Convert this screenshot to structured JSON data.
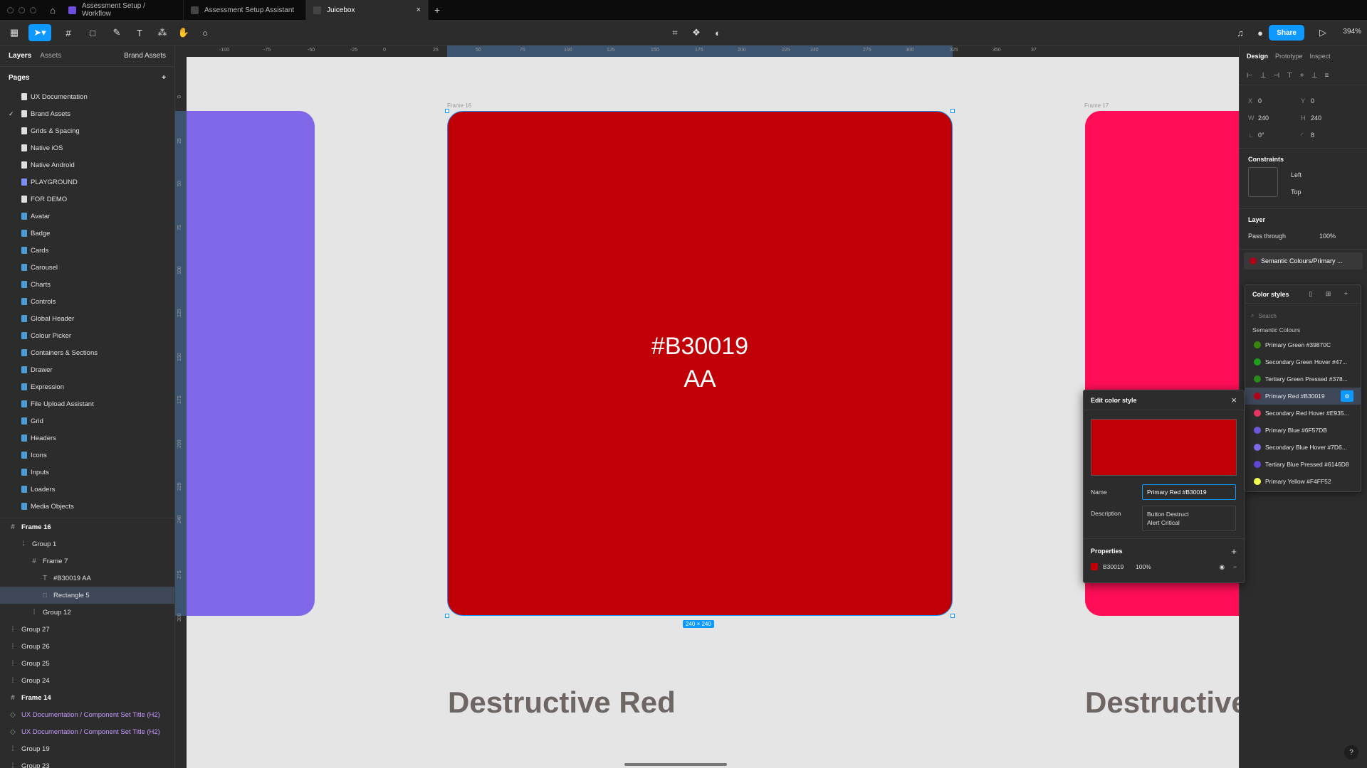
{
  "tabs": [
    {
      "label": "Assessment Setup / Workflow",
      "active": false
    },
    {
      "label": "Assessment Setup Assistant",
      "active": false
    },
    {
      "label": "Juicebox",
      "active": true
    }
  ],
  "toolbar": {
    "share_label": "Share",
    "zoom": "394%"
  },
  "left_panel": {
    "tab_layers": "Layers",
    "tab_assets": "Assets",
    "page_selector": "Brand Assets",
    "pages_title": "Pages",
    "pages": [
      "UX Documentation",
      "Brand Assets",
      "Grids & Spacing",
      "Native iOS",
      "Native Android",
      "PLAYGROUND",
      "FOR DEMO",
      "Avatar",
      "Badge",
      "Cards",
      "Carousel",
      "Charts",
      "Controls",
      "Global Header",
      "Colour Picker",
      "Containers & Sections",
      "Drawer",
      "Expression",
      "File Upload Assistant",
      "Grid",
      "Headers",
      "Icons",
      "Inputs",
      "Loaders",
      "Media Objects"
    ],
    "layers": [
      {
        "label": "Frame 16",
        "indent": 0,
        "icon": "#",
        "bold": true
      },
      {
        "label": "Group 1",
        "indent": 1,
        "icon": "⁞"
      },
      {
        "label": "Frame 7",
        "indent": 2,
        "icon": "#"
      },
      {
        "label": "#B30019 AA",
        "indent": 3,
        "icon": "T"
      },
      {
        "label": "Rectangle 5",
        "indent": 3,
        "icon": "□",
        "highlight": true
      },
      {
        "label": "Group 12",
        "indent": 2,
        "icon": "⁞"
      },
      {
        "label": "Group 27",
        "indent": 0,
        "icon": "⁞"
      },
      {
        "label": "Group 26",
        "indent": 0,
        "icon": "⁞"
      },
      {
        "label": "Group 25",
        "indent": 0,
        "icon": "⁞"
      },
      {
        "label": "Group 24",
        "indent": 0,
        "icon": "⁞"
      },
      {
        "label": "Frame 14",
        "indent": 0,
        "icon": "#",
        "bold": true
      },
      {
        "label": "UX Documentation / Component Set Title (H2)",
        "indent": 0,
        "icon": "◇",
        "purple": true
      },
      {
        "label": "UX Documentation / Component Set Title (H2)",
        "indent": 0,
        "icon": "◇",
        "purple": true
      },
      {
        "label": "Group 19",
        "indent": 0,
        "icon": "⁞"
      },
      {
        "label": "Group 23",
        "indent": 0,
        "icon": "⁞"
      }
    ]
  },
  "canvas": {
    "frame16_label": "Frame 16",
    "frame17_label": "Frame 17",
    "card_hex": "#B30019",
    "card_rating": "AA",
    "size_badge": "240 × 240",
    "title_left": "Destructive Red",
    "title_right": "Destructive",
    "ruler_top": [
      "-100",
      "-75",
      "-50",
      "-25",
      "0",
      "25",
      "50",
      "75",
      "100",
      "125",
      "150",
      "175",
      "200",
      "225",
      "240",
      "275",
      "300",
      "325",
      "350",
      "37"
    ],
    "ruler_left": [
      "0",
      "25",
      "50",
      "75",
      "100",
      "125",
      "150",
      "175",
      "200",
      "225",
      "240",
      "275",
      "300"
    ]
  },
  "right_panel": {
    "tab_design": "Design",
    "tab_prototype": "Prototype",
    "tab_inspect": "Inspect",
    "x": "0",
    "y": "0",
    "w": "240",
    "h": "240",
    "rotation": "0°",
    "radius": "8",
    "constraints_title": "Constraints",
    "constraint_h": "Left",
    "constraint_v": "Top",
    "layer_title": "Layer",
    "blend": "Pass through",
    "opacity": "100%",
    "fill_style": "Semantic Colours/Primary ..."
  },
  "color_styles": {
    "title": "Color styles",
    "search_placeholder": "Search",
    "group": "Semantic Colours",
    "items": [
      {
        "label": "Primary Green #39870C",
        "color": "#39870C"
      },
      {
        "label": "Secondary Green Hover #47...",
        "color": "#1f9e1f"
      },
      {
        "label": "Tertiary Green Pressed #378...",
        "color": "#2a8a1a"
      },
      {
        "label": "Primary Red #B30019",
        "color": "#B30019",
        "selected": true
      },
      {
        "label": "Secondary Red Hover #E935...",
        "color": "#E93560"
      },
      {
        "label": "Primary Blue #6F57DB",
        "color": "#6F57DB"
      },
      {
        "label": "Secondary Blue Hover #7D6...",
        "color": "#7D6AE6"
      },
      {
        "label": "Tertiary Blue Pressed #6146D8",
        "color": "#6146D8"
      },
      {
        "label": "Primary Yellow #F4FF52",
        "color": "#F4FF52"
      }
    ]
  },
  "edit_style": {
    "title": "Edit color style",
    "name_label": "Name",
    "name_value": "Primary Red #B30019",
    "description_label": "Description",
    "description_line1": "Button Destruct",
    "description_line2": "Alert Critical",
    "properties_label": "Properties",
    "fill_hex": "B30019",
    "fill_opacity": "100%"
  },
  "colors": {
    "accent": "#0d99ff",
    "card_red": "#c00006",
    "card_purple": "#7f67e8",
    "card_pink": "#ff0e57"
  }
}
